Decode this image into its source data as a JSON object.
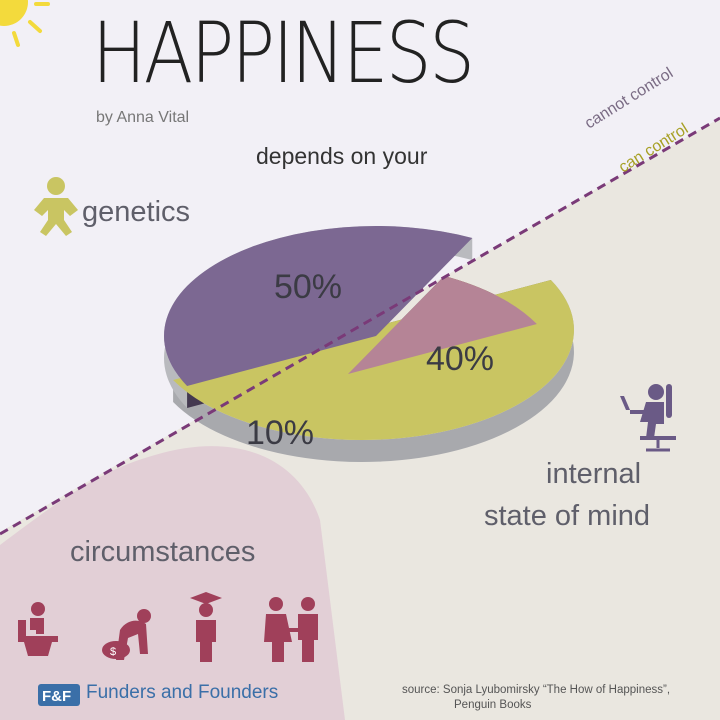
{
  "header": {
    "title": "HAPPINESS",
    "byline": "by Anna Vital",
    "subtitle": "depends on your"
  },
  "divider": {
    "upper_label": "cannot control",
    "lower_label": "can control"
  },
  "labels": {
    "genetics": "genetics",
    "internal_line1": "internal",
    "internal_line2": "state of mind",
    "circumstances": "circumstances"
  },
  "footer": {
    "brand": "Funders and Founders",
    "source_line1": "source: Sonja Lyubomirsky “The How of Happiness”,",
    "source_line2": "Penguin Books"
  },
  "icons": [
    "sun-icon",
    "baby-icon",
    "person-at-desk-icon",
    "toilet-icon",
    "sad-person-money-icon",
    "graduate-icon",
    "couple-icon",
    "brand-logo-icon"
  ],
  "colors": {
    "genetics": "#c9c562",
    "internal": "#7c6892",
    "circumstances": "#b58496",
    "divider": "#7a3a78",
    "sun": "#f3da3c"
  },
  "chart_data": {
    "type": "pie",
    "title": "HAPPINESS",
    "subtitle": "depends on your",
    "slices": [
      {
        "label": "genetics",
        "value": 50,
        "display": "50%",
        "color": "#c9c562"
      },
      {
        "label": "internal state of mind",
        "value": 40,
        "display": "40%",
        "color": "#7c6892"
      },
      {
        "label": "circumstances",
        "value": 10,
        "display": "10%",
        "color": "#b58496"
      }
    ]
  }
}
